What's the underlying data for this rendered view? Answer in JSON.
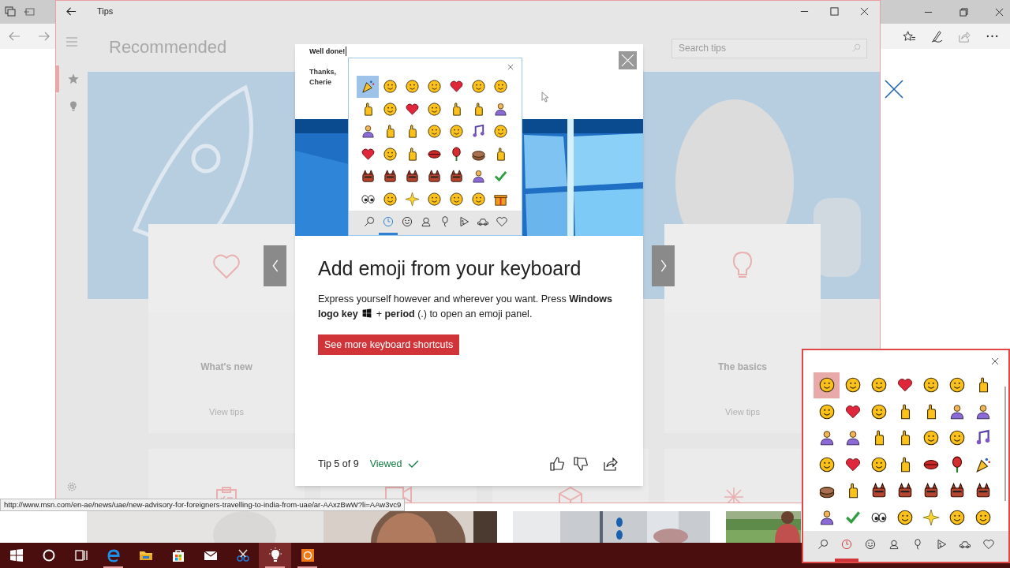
{
  "browser": {
    "status_url": "http://www.msn.com/en-ae/news/uae/new-advisory-for-foreigners-travelling-to-india-from-uae/ar-AAxzBwW?li=AAw3vc9"
  },
  "tips_window": {
    "title": "Tips",
    "heading": "Recommended",
    "search": {
      "placeholder": "Search tips"
    },
    "rail": [
      {
        "kind": "star",
        "selected": true
      },
      {
        "kind": "bulb",
        "selected": false
      }
    ],
    "cards": [
      {
        "kind": "heart",
        "title": "What's new",
        "link": "View tips"
      },
      {
        "kind": "bulb",
        "title": "The basics",
        "link": "View tips"
      }
    ]
  },
  "tip_dialog": {
    "email": [
      "Well done!",
      "Thanks,",
      "Cherie"
    ],
    "emoji_panel": {
      "emojis": [
        {
          "kind": "popper",
          "selected": true
        },
        {
          "kind": "face",
          "selected": false
        },
        {
          "kind": "face",
          "selected": false
        },
        {
          "kind": "face",
          "selected": false
        },
        {
          "kind": "heart",
          "selected": false
        },
        {
          "kind": "face",
          "selected": false
        },
        {
          "kind": "face",
          "selected": false
        },
        {
          "kind": "hand",
          "selected": false
        },
        {
          "kind": "face",
          "selected": false
        },
        {
          "kind": "heart",
          "selected": false
        },
        {
          "kind": "face",
          "selected": false
        },
        {
          "kind": "hand",
          "selected": false
        },
        {
          "kind": "hand",
          "selected": false
        },
        {
          "kind": "person",
          "selected": false
        },
        {
          "kind": "person",
          "selected": false
        },
        {
          "kind": "hand",
          "selected": false
        },
        {
          "kind": "hand",
          "selected": false
        },
        {
          "kind": "face",
          "selected": false
        },
        {
          "kind": "face",
          "selected": false
        },
        {
          "kind": "note",
          "selected": false
        },
        {
          "kind": "face",
          "selected": false
        },
        {
          "kind": "heart",
          "selected": false
        },
        {
          "kind": "face",
          "selected": false
        },
        {
          "kind": "hand",
          "selected": false
        },
        {
          "kind": "lips",
          "selected": false
        },
        {
          "kind": "rose",
          "selected": false
        },
        {
          "kind": "cake",
          "selected": false
        },
        {
          "kind": "hand",
          "selected": false
        },
        {
          "kind": "animal",
          "selected": false
        },
        {
          "kind": "animal",
          "selected": false
        },
        {
          "kind": "animal",
          "selected": false
        },
        {
          "kind": "animal",
          "selected": false
        },
        {
          "kind": "animal",
          "selected": false
        },
        {
          "kind": "person",
          "selected": false
        },
        {
          "kind": "check",
          "selected": false
        },
        {
          "kind": "eyes",
          "selected": false
        },
        {
          "kind": "face",
          "selected": false
        },
        {
          "kind": "sparkle",
          "selected": false
        },
        {
          "kind": "face",
          "selected": false
        },
        {
          "kind": "face",
          "selected": false
        },
        {
          "kind": "face",
          "selected": false
        },
        {
          "kind": "gift",
          "selected": false
        }
      ],
      "categories": [
        {
          "kind": "search",
          "selected": false
        },
        {
          "kind": "clock",
          "selected": true
        },
        {
          "kind": "smiley",
          "selected": false
        },
        {
          "kind": "person",
          "selected": false
        },
        {
          "kind": "balloon",
          "selected": false
        },
        {
          "kind": "pizza",
          "selected": false
        },
        {
          "kind": "car",
          "selected": false
        },
        {
          "kind": "heart",
          "selected": false
        }
      ]
    },
    "title": "Add emoji from your keyboard",
    "description": [
      "Express yourself however and wherever you want. Press **Windows logo key**",
      "+ **period** (.) to open an emoji panel."
    ],
    "button": "See more keyboard shortcuts",
    "counter": "Tip 5 of 9",
    "status": "Viewed"
  },
  "emoji_panel": {
    "emojis": [
      {
        "kind": "face",
        "selected": true
      },
      {
        "kind": "face",
        "selected": false
      },
      {
        "kind": "face",
        "selected": false
      },
      {
        "kind": "heart",
        "selected": false
      },
      {
        "kind": "face",
        "selected": false
      },
      {
        "kind": "face",
        "selected": false
      },
      {
        "kind": "hand",
        "selected": false
      },
      {
        "kind": "face",
        "selected": false
      },
      {
        "kind": "heart",
        "selected": false
      },
      {
        "kind": "face",
        "selected": false
      },
      {
        "kind": "hand",
        "selected": false
      },
      {
        "kind": "hand",
        "selected": false
      },
      {
        "kind": "person",
        "selected": false
      },
      {
        "kind": "person",
        "selected": false
      },
      {
        "kind": "person",
        "selected": false
      },
      {
        "kind": "person",
        "selected": false
      },
      {
        "kind": "hand",
        "selected": false
      },
      {
        "kind": "hand",
        "selected": false
      },
      {
        "kind": "face",
        "selected": false
      },
      {
        "kind": "face",
        "selected": false
      },
      {
        "kind": "note",
        "selected": false
      },
      {
        "kind": "face",
        "selected": false
      },
      {
        "kind": "heart",
        "selected": false
      },
      {
        "kind": "face",
        "selected": false
      },
      {
        "kind": "hand",
        "selected": false
      },
      {
        "kind": "lips",
        "selected": false
      },
      {
        "kind": "rose",
        "selected": false
      },
      {
        "kind": "popper",
        "selected": false
      },
      {
        "kind": "cake",
        "selected": false
      },
      {
        "kind": "hand",
        "selected": false
      },
      {
        "kind": "animal",
        "selected": false
      },
      {
        "kind": "animal",
        "selected": false
      },
      {
        "kind": "animal",
        "selected": false
      },
      {
        "kind": "animal",
        "selected": false
      },
      {
        "kind": "animal",
        "selected": false
      },
      {
        "kind": "person",
        "selected": false
      },
      {
        "kind": "check",
        "selected": false
      },
      {
        "kind": "eyes",
        "selected": false
      },
      {
        "kind": "face",
        "selected": false
      },
      {
        "kind": "sparkle",
        "selected": false
      },
      {
        "kind": "face",
        "selected": false
      },
      {
        "kind": "face",
        "selected": false
      }
    ],
    "categories": [
      {
        "kind": "search",
        "selected": false
      },
      {
        "kind": "clock",
        "selected": true
      },
      {
        "kind": "smiley",
        "selected": false
      },
      {
        "kind": "person",
        "selected": false
      },
      {
        "kind": "balloon",
        "selected": false
      },
      {
        "kind": "pizza",
        "selected": false
      },
      {
        "kind": "car",
        "selected": false
      },
      {
        "kind": "heart",
        "selected": false
      }
    ]
  },
  "taskbar": {
    "apps": [
      {
        "kind": "start",
        "running": false,
        "selected": false
      },
      {
        "kind": "cortana",
        "running": false,
        "selected": false
      },
      {
        "kind": "taskview",
        "running": false,
        "selected": false
      },
      {
        "kind": "browser",
        "running": true,
        "selected": false
      },
      {
        "kind": "folder",
        "running": false,
        "selected": false
      },
      {
        "kind": "store",
        "running": false,
        "selected": false
      },
      {
        "kind": "mail",
        "running": false,
        "selected": false
      },
      {
        "kind": "snip",
        "running": false,
        "selected": false
      },
      {
        "kind": "bulb",
        "running": true,
        "selected": true
      },
      {
        "kind": "app",
        "running": true,
        "selected": false
      }
    ]
  }
}
